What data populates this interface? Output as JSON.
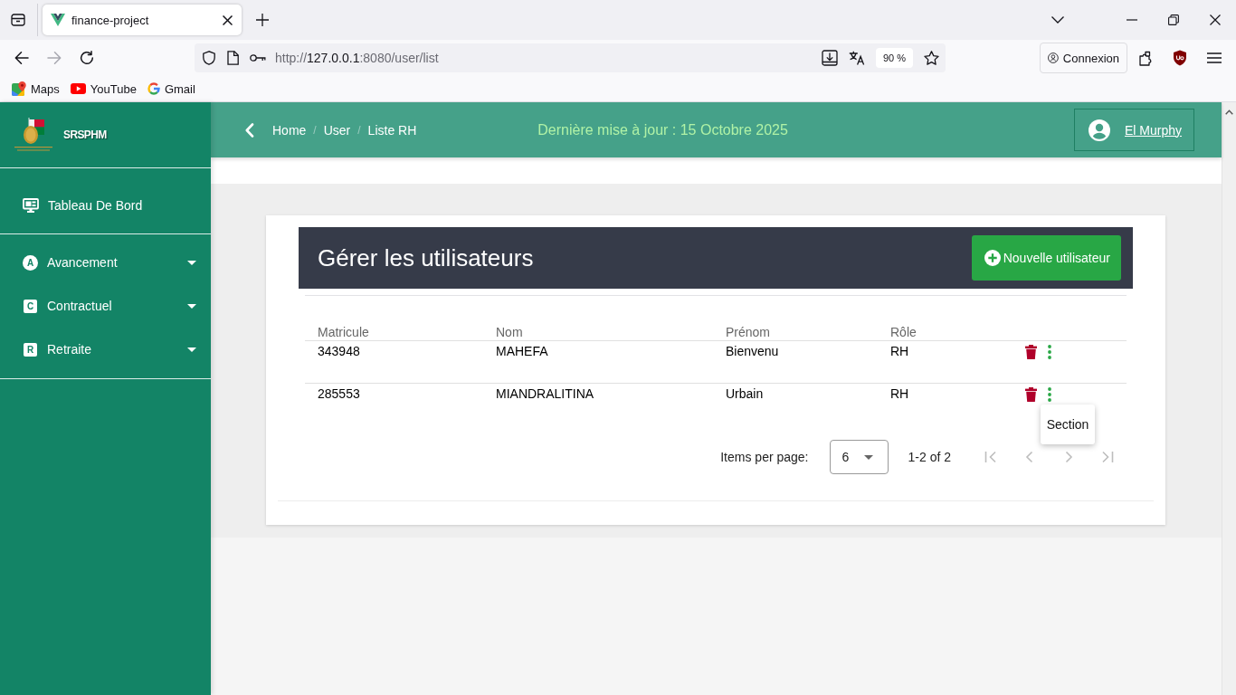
{
  "browser": {
    "tabs": [
      {
        "title": "finance-project",
        "selected": true
      }
    ],
    "nav_buttons": [
      {
        "kind": "back",
        "disabled": false
      },
      {
        "kind": "forward",
        "disabled": true
      },
      {
        "kind": "reload",
        "disabled": false
      }
    ],
    "address": {
      "scheme": "http://",
      "host": "127.0.0.1",
      "path": ":8080/user/list"
    },
    "zoom": "90 %",
    "sign_in": "Connexion",
    "bookmarks": [
      {
        "kind": "maps",
        "label": "Maps"
      },
      {
        "kind": "youtube",
        "label": "YouTube"
      },
      {
        "kind": "gmail",
        "label": "Gmail"
      }
    ]
  },
  "sidebar": {
    "brand": "SRSPHM",
    "dashboard": "Tableau De Bord",
    "items": [
      {
        "label": "Avancement",
        "badge": "A",
        "kind": "circle",
        "expanded": false
      },
      {
        "label": "Contractuel",
        "badge": "C",
        "kind": "square",
        "expanded": false
      },
      {
        "label": "Retraite",
        "badge": "R",
        "kind": "square",
        "expanded": false
      }
    ]
  },
  "header": {
    "breadcrumbs": [
      "Home",
      "User",
      "Liste RH"
    ],
    "separators": [
      "/",
      "/"
    ],
    "last_update": "Dernière mise à jour : 15 Octobre 2025",
    "user": "El Murphy"
  },
  "panel": {
    "title": "Gérer les utilisateurs",
    "new_button": "Nouvelle utilisateur",
    "table": {
      "columns": [
        "Matricule",
        "Nom",
        "Prénom",
        "Rôle"
      ],
      "rows": [
        {
          "cells": [
            "343948",
            "MAHEFA",
            "Bienvenu",
            "RH"
          ],
          "menu_open": false
        },
        {
          "cells": [
            "285553",
            "MIANDRALITINA",
            "Urbain",
            "RH"
          ],
          "menu_open": true,
          "menu_items": [
            "Section"
          ]
        }
      ]
    },
    "pagination": {
      "label": "Items per page:",
      "page_size": "6",
      "range": "1-2 of 2",
      "buttons": [
        {
          "kind": "first",
          "disabled": true
        },
        {
          "kind": "prev",
          "disabled": true
        },
        {
          "kind": "next",
          "disabled": true
        },
        {
          "kind": "last",
          "disabled": true
        }
      ]
    }
  }
}
